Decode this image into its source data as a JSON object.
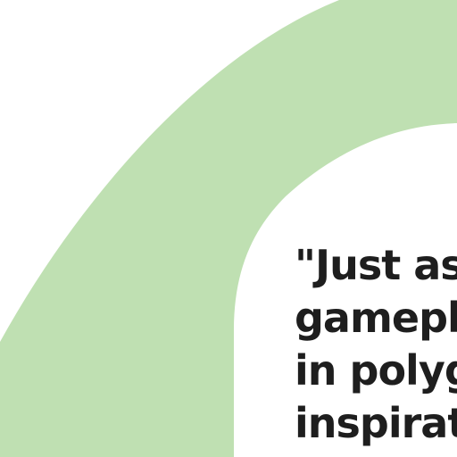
{
  "colors": {
    "background": "#ffffff",
    "arc_band": "#bfe0b2",
    "text": "#1e1e1e"
  },
  "quote": {
    "lines": [
      "\"Just as",
      "gamepl",
      "in polyg",
      "inspirat"
    ]
  }
}
